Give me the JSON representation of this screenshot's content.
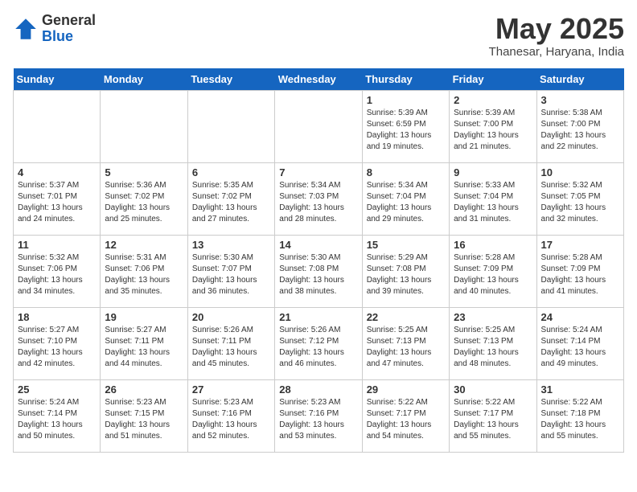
{
  "logo": {
    "general": "General",
    "blue": "Blue"
  },
  "title": "May 2025",
  "subtitle": "Thanesar, Haryana, India",
  "days": [
    "Sunday",
    "Monday",
    "Tuesday",
    "Wednesday",
    "Thursday",
    "Friday",
    "Saturday"
  ],
  "weeks": [
    [
      {
        "num": "",
        "content": ""
      },
      {
        "num": "",
        "content": ""
      },
      {
        "num": "",
        "content": ""
      },
      {
        "num": "",
        "content": ""
      },
      {
        "num": "1",
        "content": "Sunrise: 5:39 AM\nSunset: 6:59 PM\nDaylight: 13 hours\nand 19 minutes."
      },
      {
        "num": "2",
        "content": "Sunrise: 5:39 AM\nSunset: 7:00 PM\nDaylight: 13 hours\nand 21 minutes."
      },
      {
        "num": "3",
        "content": "Sunrise: 5:38 AM\nSunset: 7:00 PM\nDaylight: 13 hours\nand 22 minutes."
      }
    ],
    [
      {
        "num": "4",
        "content": "Sunrise: 5:37 AM\nSunset: 7:01 PM\nDaylight: 13 hours\nand 24 minutes."
      },
      {
        "num": "5",
        "content": "Sunrise: 5:36 AM\nSunset: 7:02 PM\nDaylight: 13 hours\nand 25 minutes."
      },
      {
        "num": "6",
        "content": "Sunrise: 5:35 AM\nSunset: 7:02 PM\nDaylight: 13 hours\nand 27 minutes."
      },
      {
        "num": "7",
        "content": "Sunrise: 5:34 AM\nSunset: 7:03 PM\nDaylight: 13 hours\nand 28 minutes."
      },
      {
        "num": "8",
        "content": "Sunrise: 5:34 AM\nSunset: 7:04 PM\nDaylight: 13 hours\nand 29 minutes."
      },
      {
        "num": "9",
        "content": "Sunrise: 5:33 AM\nSunset: 7:04 PM\nDaylight: 13 hours\nand 31 minutes."
      },
      {
        "num": "10",
        "content": "Sunrise: 5:32 AM\nSunset: 7:05 PM\nDaylight: 13 hours\nand 32 minutes."
      }
    ],
    [
      {
        "num": "11",
        "content": "Sunrise: 5:32 AM\nSunset: 7:06 PM\nDaylight: 13 hours\nand 34 minutes."
      },
      {
        "num": "12",
        "content": "Sunrise: 5:31 AM\nSunset: 7:06 PM\nDaylight: 13 hours\nand 35 minutes."
      },
      {
        "num": "13",
        "content": "Sunrise: 5:30 AM\nSunset: 7:07 PM\nDaylight: 13 hours\nand 36 minutes."
      },
      {
        "num": "14",
        "content": "Sunrise: 5:30 AM\nSunset: 7:08 PM\nDaylight: 13 hours\nand 38 minutes."
      },
      {
        "num": "15",
        "content": "Sunrise: 5:29 AM\nSunset: 7:08 PM\nDaylight: 13 hours\nand 39 minutes."
      },
      {
        "num": "16",
        "content": "Sunrise: 5:28 AM\nSunset: 7:09 PM\nDaylight: 13 hours\nand 40 minutes."
      },
      {
        "num": "17",
        "content": "Sunrise: 5:28 AM\nSunset: 7:09 PM\nDaylight: 13 hours\nand 41 minutes."
      }
    ],
    [
      {
        "num": "18",
        "content": "Sunrise: 5:27 AM\nSunset: 7:10 PM\nDaylight: 13 hours\nand 42 minutes."
      },
      {
        "num": "19",
        "content": "Sunrise: 5:27 AM\nSunset: 7:11 PM\nDaylight: 13 hours\nand 44 minutes."
      },
      {
        "num": "20",
        "content": "Sunrise: 5:26 AM\nSunset: 7:11 PM\nDaylight: 13 hours\nand 45 minutes."
      },
      {
        "num": "21",
        "content": "Sunrise: 5:26 AM\nSunset: 7:12 PM\nDaylight: 13 hours\nand 46 minutes."
      },
      {
        "num": "22",
        "content": "Sunrise: 5:25 AM\nSunset: 7:13 PM\nDaylight: 13 hours\nand 47 minutes."
      },
      {
        "num": "23",
        "content": "Sunrise: 5:25 AM\nSunset: 7:13 PM\nDaylight: 13 hours\nand 48 minutes."
      },
      {
        "num": "24",
        "content": "Sunrise: 5:24 AM\nSunset: 7:14 PM\nDaylight: 13 hours\nand 49 minutes."
      }
    ],
    [
      {
        "num": "25",
        "content": "Sunrise: 5:24 AM\nSunset: 7:14 PM\nDaylight: 13 hours\nand 50 minutes."
      },
      {
        "num": "26",
        "content": "Sunrise: 5:23 AM\nSunset: 7:15 PM\nDaylight: 13 hours\nand 51 minutes."
      },
      {
        "num": "27",
        "content": "Sunrise: 5:23 AM\nSunset: 7:16 PM\nDaylight: 13 hours\nand 52 minutes."
      },
      {
        "num": "28",
        "content": "Sunrise: 5:23 AM\nSunset: 7:16 PM\nDaylight: 13 hours\nand 53 minutes."
      },
      {
        "num": "29",
        "content": "Sunrise: 5:22 AM\nSunset: 7:17 PM\nDaylight: 13 hours\nand 54 minutes."
      },
      {
        "num": "30",
        "content": "Sunrise: 5:22 AM\nSunset: 7:17 PM\nDaylight: 13 hours\nand 55 minutes."
      },
      {
        "num": "31",
        "content": "Sunrise: 5:22 AM\nSunset: 7:18 PM\nDaylight: 13 hours\nand 55 minutes."
      }
    ]
  ]
}
